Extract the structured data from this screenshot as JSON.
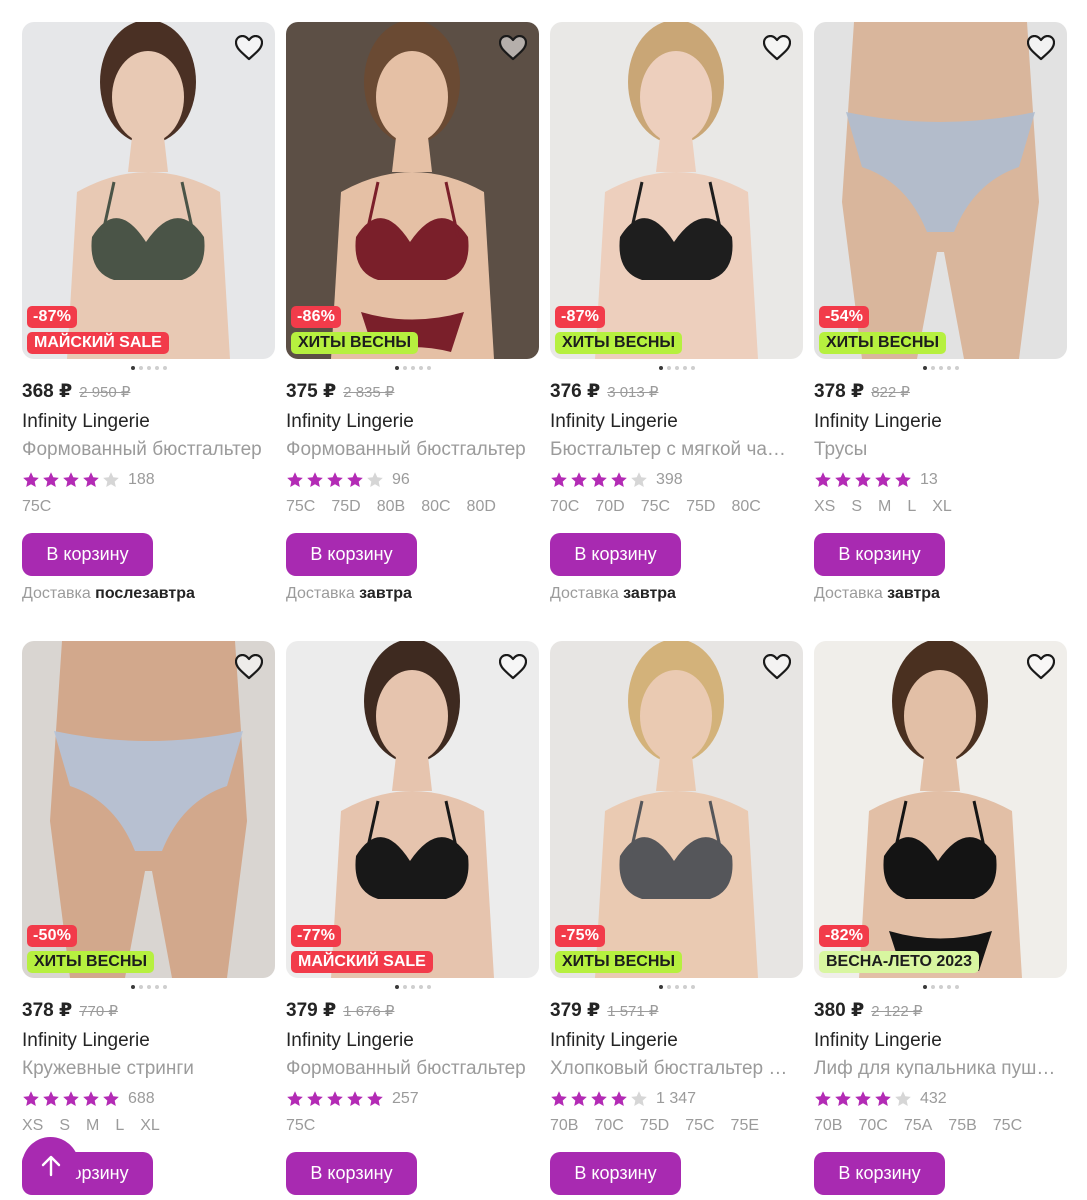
{
  "accent_color": "#a82ab1",
  "discount_color": "#f23b4a",
  "star_color": "#b32bb5",
  "products": [
    {
      "price": "368 ₽",
      "old_price": "2 950 ₽",
      "brand": "Infinity Lingerie",
      "title": "Формованный бюстгальтер",
      "rating": 4,
      "reviews": "188",
      "sizes": [
        "75C"
      ],
      "discount": "-87%",
      "promo": "МАЙСКИЙ SALE",
      "promo_bg": "#f23b4a",
      "promo_fg": "#ffffff",
      "button": "В корзину",
      "delivery_label": "Доставка",
      "delivery_day": "послезавтра",
      "photo": {
        "bg": "#e6e7e9",
        "garment": "#4a5447",
        "skin": "#e8c9b4",
        "hair": "#4a3024",
        "type": "bra"
      },
      "image_count": 5,
      "favorite": false
    },
    {
      "price": "375 ₽",
      "old_price": "2 835 ₽",
      "brand": "Infinity Lingerie",
      "title": "Формованный бюстгальтер",
      "rating": 4,
      "reviews": "96",
      "sizes": [
        "75C",
        "75D",
        "80B",
        "80C",
        "80D"
      ],
      "discount": "-86%",
      "promo": "ХИТЫ ВЕСНЫ",
      "promo_bg": "#b6f03f",
      "promo_fg": "#1d1d1d",
      "button": "В корзину",
      "delivery_label": "Доставка",
      "delivery_day": "завтра",
      "photo": {
        "bg": "#5c4f45",
        "garment": "#7a1f2a",
        "skin": "#e5c0a5",
        "hair": "#6a4a33",
        "type": "set"
      },
      "image_count": 5,
      "favorite": false
    },
    {
      "price": "376 ₽",
      "old_price": "3 013 ₽",
      "brand": "Infinity Lingerie",
      "title": "Бюстгальтер с мягкой чашкой",
      "rating": 4,
      "reviews": "398",
      "sizes": [
        "70C",
        "70D",
        "75C",
        "75D",
        "80C"
      ],
      "discount": "-87%",
      "promo": "ХИТЫ ВЕСНЫ",
      "promo_bg": "#b6f03f",
      "promo_fg": "#1d1d1d",
      "button": "В корзину",
      "delivery_label": "Доставка",
      "delivery_day": "завтра",
      "photo": {
        "bg": "#e9e8e6",
        "garment": "#1e1e1e",
        "skin": "#edcfbd",
        "hair": "#c9a676",
        "type": "bra"
      },
      "image_count": 5,
      "favorite": false
    },
    {
      "price": "378 ₽",
      "old_price": "822 ₽",
      "brand": "Infinity Lingerie",
      "title": "Трусы",
      "rating": 5,
      "reviews": "13",
      "sizes": [
        "XS",
        "S",
        "M",
        "L",
        "XL"
      ],
      "discount": "-54%",
      "promo": "ХИТЫ ВЕСНЫ",
      "promo_bg": "#b6f03f",
      "promo_fg": "#1d1d1d",
      "button": "В корзину",
      "delivery_label": "Доставка",
      "delivery_day": "завтра",
      "photo": {
        "bg": "#e2e2e2",
        "garment": "#aebcd0",
        "skin": "#d9b69c",
        "hair": "#d9b69c",
        "type": "panty"
      },
      "image_count": 5,
      "favorite": false
    },
    {
      "price": "378 ₽",
      "old_price": "770 ₽",
      "brand": "Infinity Lingerie",
      "title": "Кружевные стринги",
      "rating": 5,
      "reviews": "688",
      "sizes": [
        "XS",
        "S",
        "M",
        "L",
        "XL"
      ],
      "discount": "-50%",
      "promo": "ХИТЫ ВЕСНЫ",
      "promo_bg": "#b6f03f",
      "promo_fg": "#1d1d1d",
      "button": "В корзину",
      "delivery_label": "",
      "delivery_day": "",
      "photo": {
        "bg": "#d9d5d1",
        "garment": "#b4c2d8",
        "skin": "#d2a88c",
        "hair": "#d2a88c",
        "type": "panty"
      },
      "image_count": 5,
      "favorite": false
    },
    {
      "price": "379 ₽",
      "old_price": "1 676 ₽",
      "brand": "Infinity Lingerie",
      "title": "Формованный бюстгальтер",
      "rating": 5,
      "reviews": "257",
      "sizes": [
        "75C"
      ],
      "discount": "-77%",
      "promo": "МАЙСКИЙ SALE",
      "promo_bg": "#f23b4a",
      "promo_fg": "#ffffff",
      "button": "В корзину",
      "delivery_label": "",
      "delivery_day": "",
      "photo": {
        "bg": "#ececec",
        "garment": "#181818",
        "skin": "#e6c4ae",
        "hair": "#3e2a20",
        "type": "bra"
      },
      "image_count": 5,
      "favorite": false
    },
    {
      "price": "379 ₽",
      "old_price": "1 571 ₽",
      "brand": "Infinity Lingerie",
      "title": "Хлопковый бюстгальтер с формованной чашкой",
      "rating": 4,
      "reviews": "1 347",
      "sizes": [
        "70B",
        "70C",
        "75D",
        "75C",
        "75E"
      ],
      "discount": "-75%",
      "promo": "ХИТЫ ВЕСНЫ",
      "promo_bg": "#b6f03f",
      "promo_fg": "#1d1d1d",
      "button": "В корзину",
      "delivery_label": "",
      "delivery_day": "",
      "photo": {
        "bg": "#e7e5e3",
        "garment": "#55565a",
        "skin": "#eacab2",
        "hair": "#d3b27a",
        "type": "bra"
      },
      "image_count": 5,
      "favorite": false
    },
    {
      "price": "380 ₽",
      "old_price": "2 122 ₽",
      "brand": "Infinity Lingerie",
      "title": "Лиф для купальника пуш-ап",
      "rating": 4,
      "reviews": "432",
      "sizes": [
        "70B",
        "70C",
        "75A",
        "75B",
        "75C"
      ],
      "discount": "-82%",
      "promo": "ВЕСНА-ЛЕТО 2023",
      "promo_bg": "#d8f6a0",
      "promo_fg": "#1d1d1d",
      "button": "В корзину",
      "delivery_label": "",
      "delivery_day": "",
      "photo": {
        "bg": "#f0eeea",
        "garment": "#141414",
        "skin": "#e2bfa6",
        "hair": "#4a3020",
        "type": "swim"
      },
      "image_count": 5,
      "favorite": false
    }
  ],
  "scroll_top_label": "arrow-up-icon"
}
